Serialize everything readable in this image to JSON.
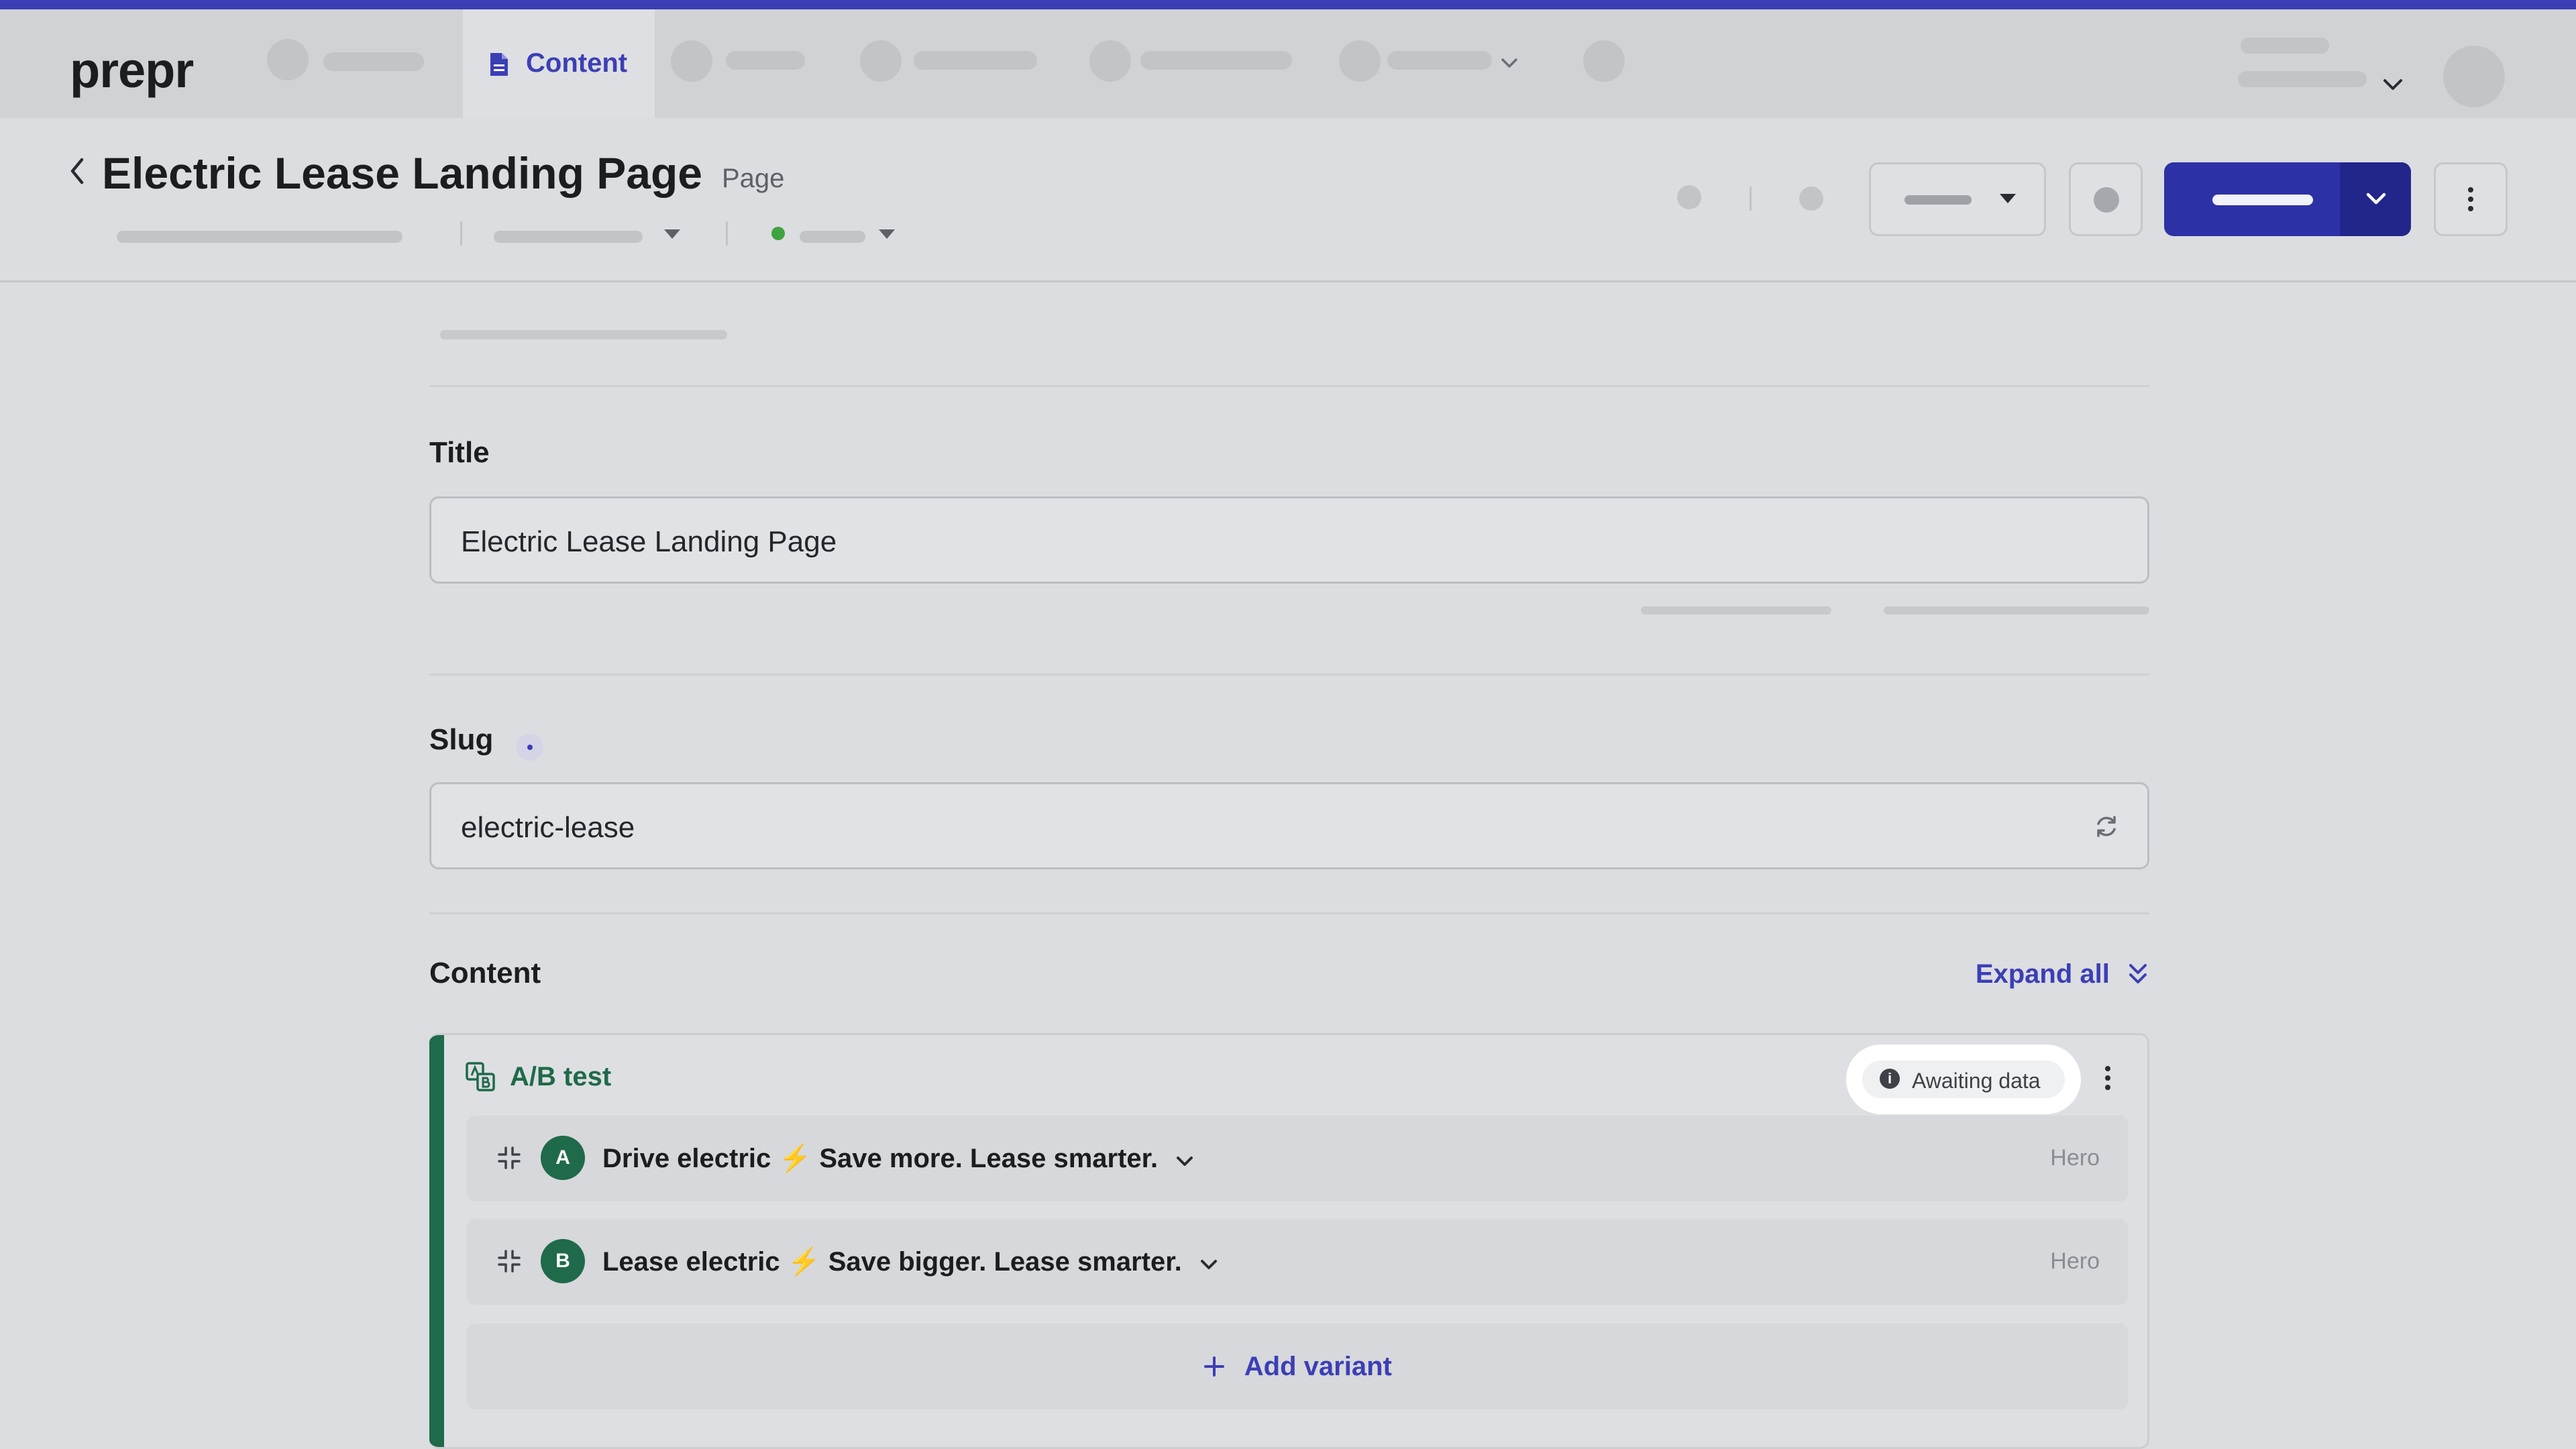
{
  "brand": {
    "logo": "prepr",
    "accent": "#3b3fb5",
    "ab_color": "#1f6a4a"
  },
  "nav": {
    "active_tab": "Content"
  },
  "header": {
    "title": "Electric Lease Landing Page",
    "type": "Page"
  },
  "form": {
    "title_label": "Title",
    "title_value": "Electric Lease Landing Page",
    "slug_label": "Slug",
    "slug_value": "electric-lease",
    "content_label": "Content",
    "expand_all": "Expand all"
  },
  "ab_test": {
    "label": "A/B test",
    "status": "Awaiting data",
    "variants": [
      {
        "letter": "A",
        "name": "Drive electric",
        "emoji": "⚡",
        "tagline": "Save more. Lease smarter.",
        "type": "Hero"
      },
      {
        "letter": "B",
        "name": "Lease electric",
        "emoji": "⚡",
        "tagline": "Save bigger. Lease smarter.",
        "type": "Hero"
      }
    ],
    "add_variant": "Add variant"
  },
  "icons": {
    "nav_content": "document-icon",
    "back": "chevron-left-icon",
    "refresh": "refresh-icon",
    "expand": "double-chevron-down-icon",
    "ab": "ab-test-icon",
    "drag": "drag-handle-icon",
    "info": "info-icon",
    "more": "kebab-icon",
    "add": "plus-icon"
  }
}
